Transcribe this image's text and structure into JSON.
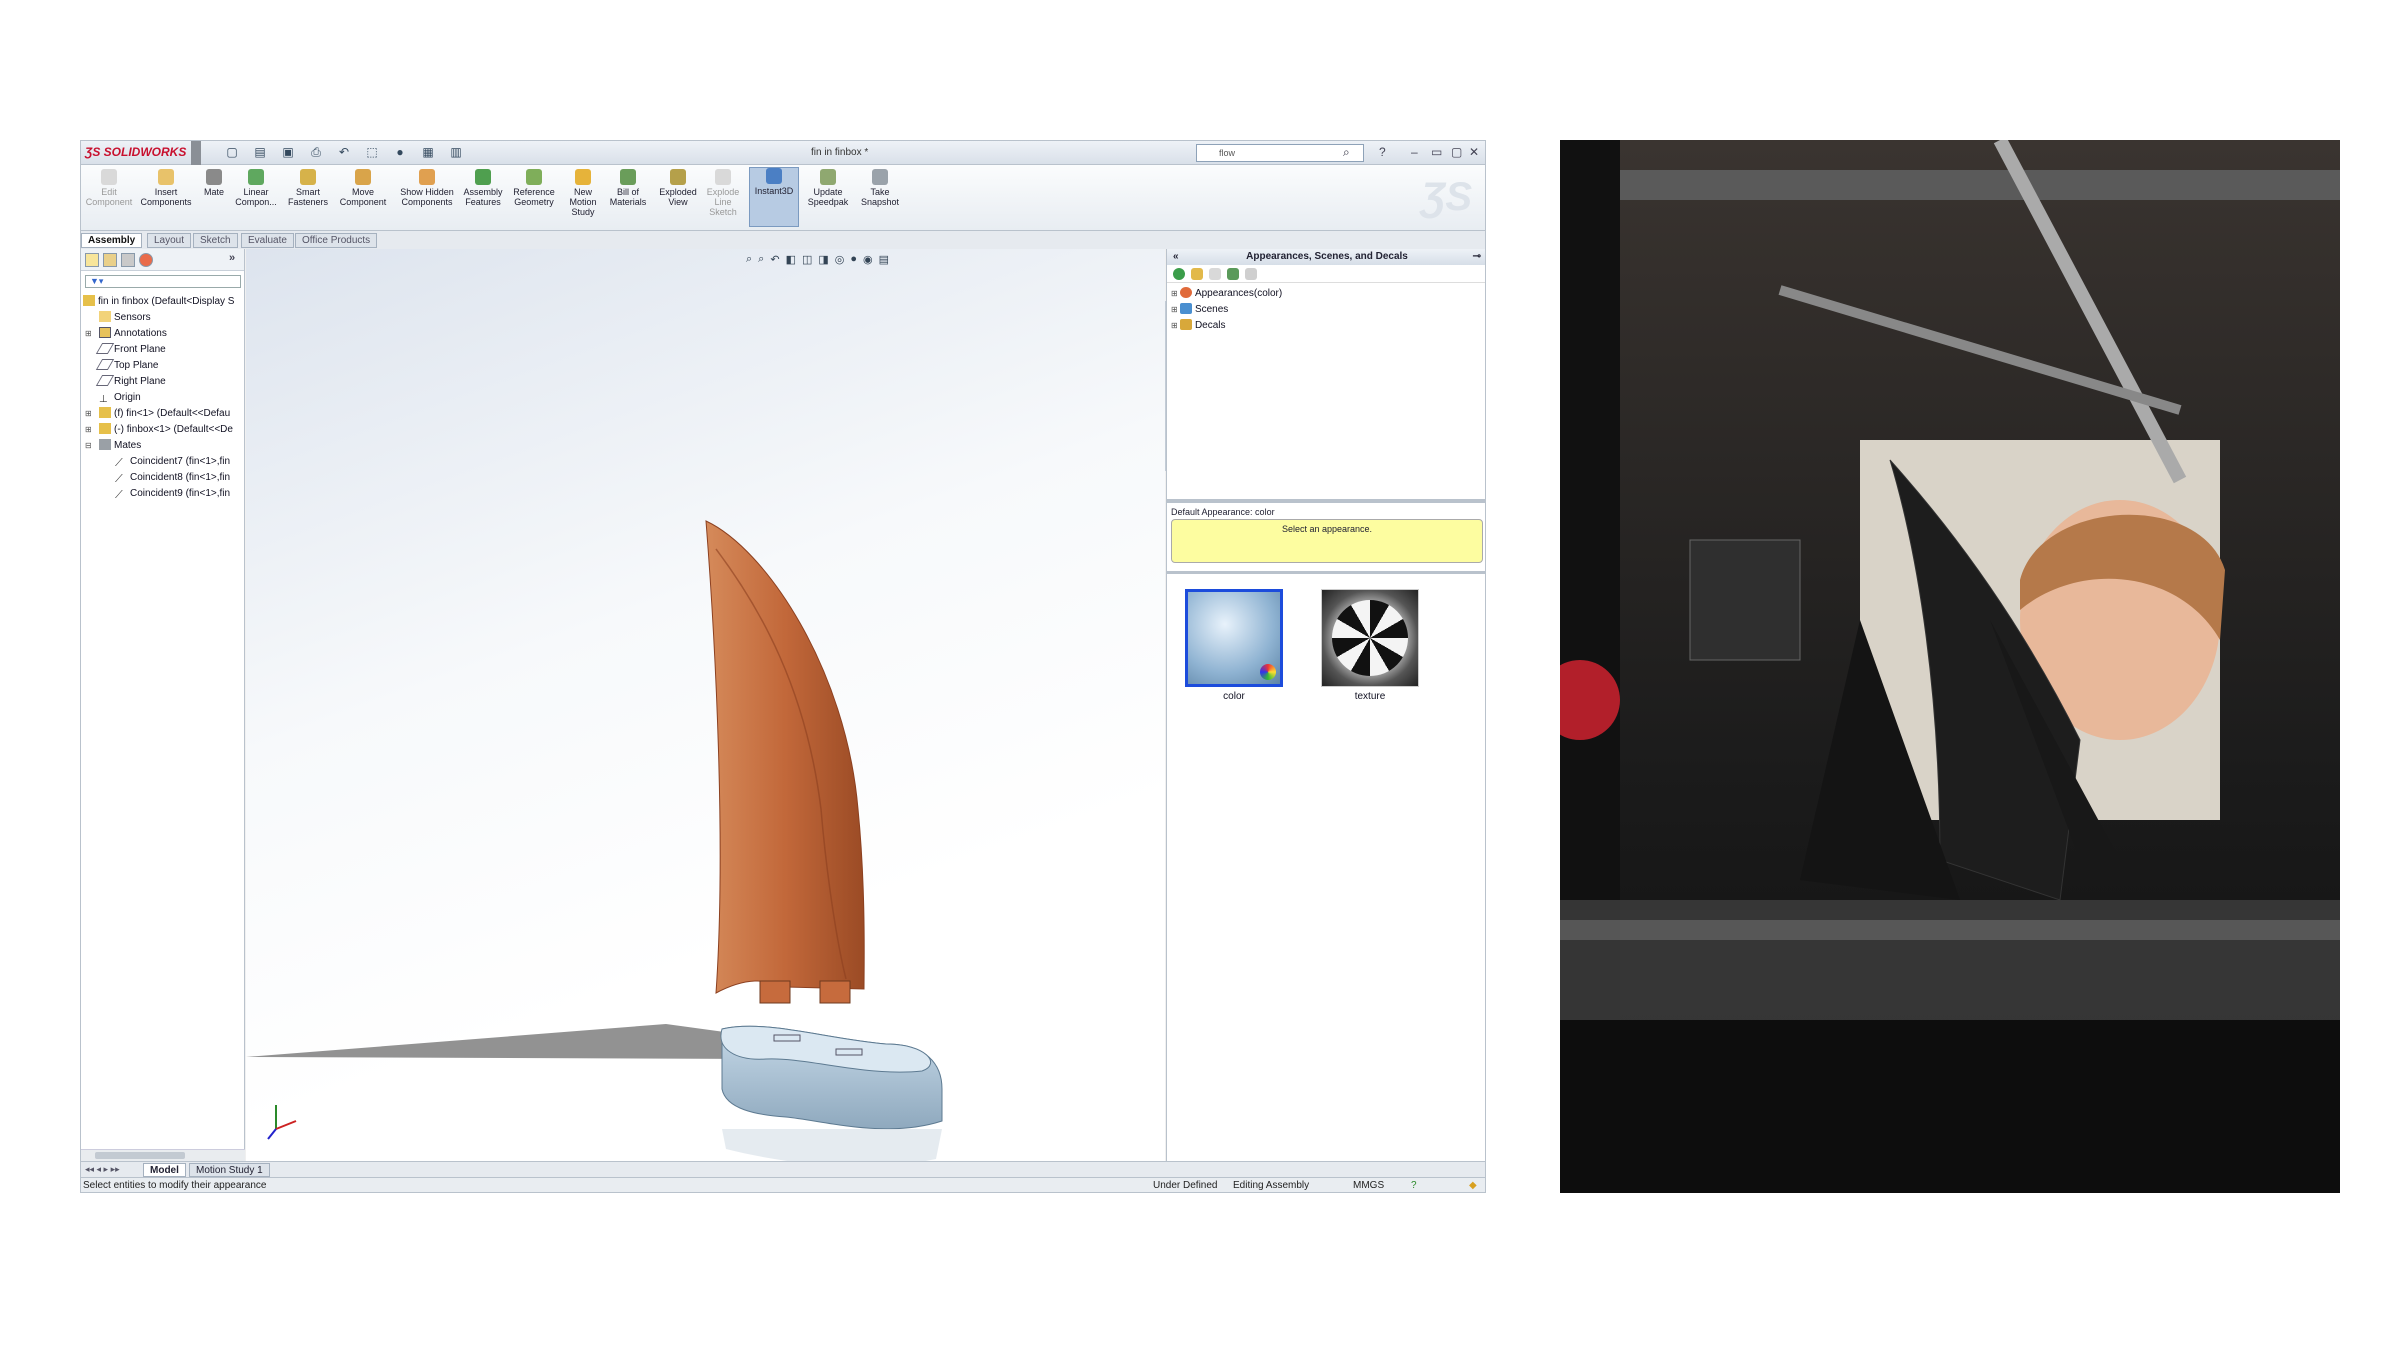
{
  "app": {
    "name": "SOLIDWORKS",
    "document_title": "fin in finbox *",
    "search_value": "flow"
  },
  "ribbon": {
    "buttons": [
      {
        "label": "Edit Component",
        "disabled": true
      },
      {
        "label": "Insert Components"
      },
      {
        "label": "Mate"
      },
      {
        "label": "Linear Compon..."
      },
      {
        "label": "Smart Fasteners"
      },
      {
        "label": "Move Component"
      },
      {
        "label": "Show Hidden Components"
      },
      {
        "label": "Assembly Features"
      },
      {
        "label": "Reference Geometry"
      },
      {
        "label": "New Motion Study"
      },
      {
        "label": "Bill of Materials"
      },
      {
        "label": "Exploded View"
      },
      {
        "label": "Explode Line Sketch",
        "disabled": true
      },
      {
        "label": "Instant3D",
        "active": true
      },
      {
        "label": "Update Speedpak"
      },
      {
        "label": "Take Snapshot"
      }
    ]
  },
  "tabs": [
    "Assembly",
    "Layout",
    "Sketch",
    "Evaluate",
    "Office Products"
  ],
  "feature_tree": {
    "root": "fin in finbox  (Default<Display S",
    "items": [
      "Sensors",
      "Annotations",
      "Front Plane",
      "Top Plane",
      "Right Plane",
      "Origin",
      "(f) fin<1> (Default<<Defau",
      "(-) finbox<1> (Default<<De",
      "Mates"
    ],
    "mates": [
      "Coincident7 (fin<1>,fin",
      "Coincident8 (fin<1>,fin",
      "Coincident9 (fin<1>,fin"
    ]
  },
  "task_pane": {
    "title": "Appearances, Scenes, and Decals",
    "library": [
      "Appearances(color)",
      "Scenes",
      "Decals"
    ],
    "default_label": "Default Appearance: color",
    "hint": "Select an appearance.",
    "thumbnails": [
      "color",
      "texture"
    ]
  },
  "bottom_tabs": [
    "Model",
    "Motion Study 1"
  ],
  "status": {
    "message": "Select entities to modify their appearance",
    "defined": "Under Defined",
    "mode": "Editing Assembly",
    "units": "MMGS"
  },
  "colors": {
    "accent": "#c8102e",
    "fin": "#c66b3d",
    "finbox": "#a9c4d9",
    "hint_bg": "#fdfda0"
  }
}
